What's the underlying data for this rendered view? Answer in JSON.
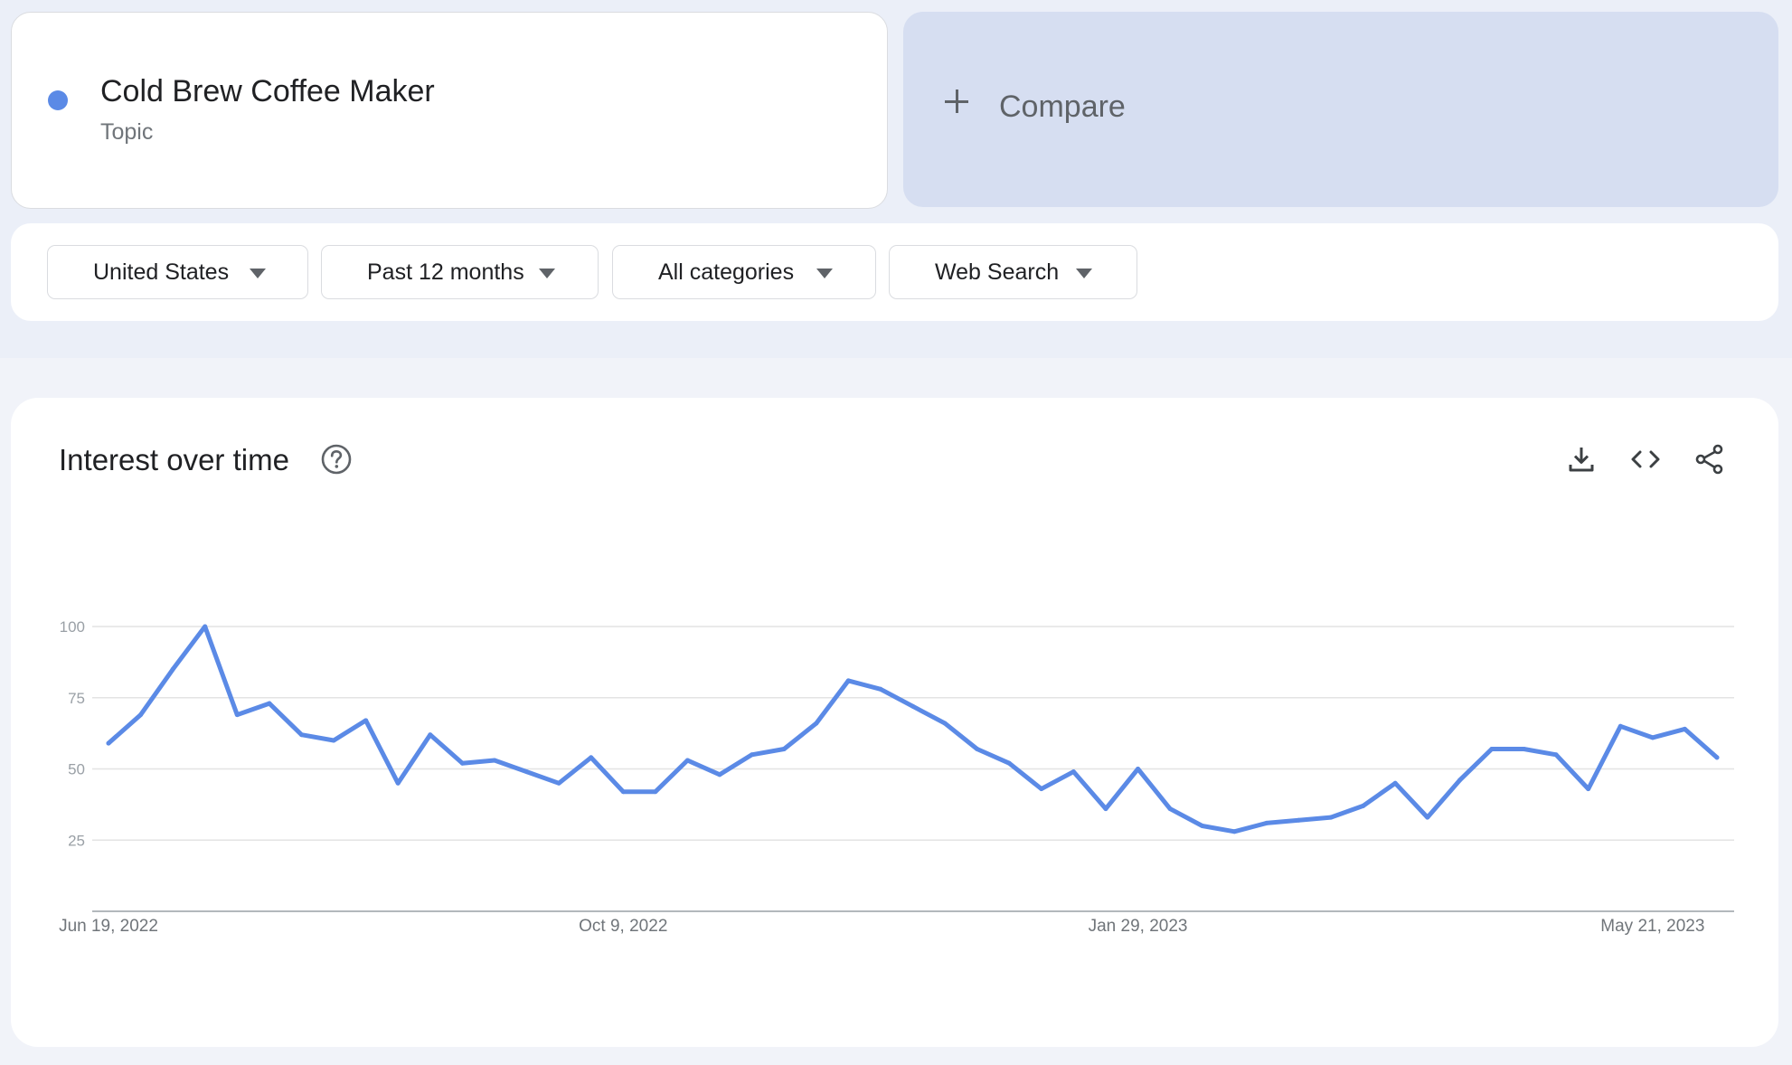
{
  "search_term": {
    "name": "Cold Brew Coffee Maker",
    "type": "Topic",
    "color": "#5b8ae6"
  },
  "compare": {
    "label": "Compare",
    "icon": "plus-icon"
  },
  "filters": [
    {
      "label": "United States",
      "icon": "caret-down-icon"
    },
    {
      "label": "Past 12 months",
      "icon": "caret-down-icon"
    },
    {
      "label": "All categories",
      "icon": "caret-down-icon"
    },
    {
      "label": "Web Search",
      "icon": "caret-down-icon"
    }
  ],
  "interest_panel": {
    "title": "Interest over time",
    "help_icon": "help-icon",
    "toolbar": [
      "download-icon",
      "embed-code-icon",
      "share-icon"
    ]
  },
  "chart_data": {
    "type": "line",
    "title": "",
    "xlabel": "",
    "ylabel": "",
    "ylim": [
      0,
      100
    ],
    "yticks": [
      25,
      50,
      75,
      100
    ],
    "xtick_labels": [
      "Jun 19, 2022",
      "Oct 9, 2022",
      "Jan 29, 2023",
      "May 21, 2023"
    ],
    "xtick_indices": [
      0,
      16,
      32,
      48
    ],
    "grid": true,
    "series": [
      {
        "color": "#5b8ae6",
        "values": [
          59,
          69,
          85,
          100,
          69,
          73,
          62,
          60,
          67,
          45,
          62,
          52,
          53,
          49,
          45,
          54,
          42,
          42,
          53,
          48,
          55,
          57,
          66,
          81,
          78,
          72,
          66,
          57,
          52,
          43,
          49,
          36,
          50,
          36,
          30,
          28,
          31,
          32,
          33,
          37,
          45,
          33,
          46,
          57,
          57,
          55,
          43,
          65,
          61,
          64,
          54
        ]
      }
    ]
  }
}
